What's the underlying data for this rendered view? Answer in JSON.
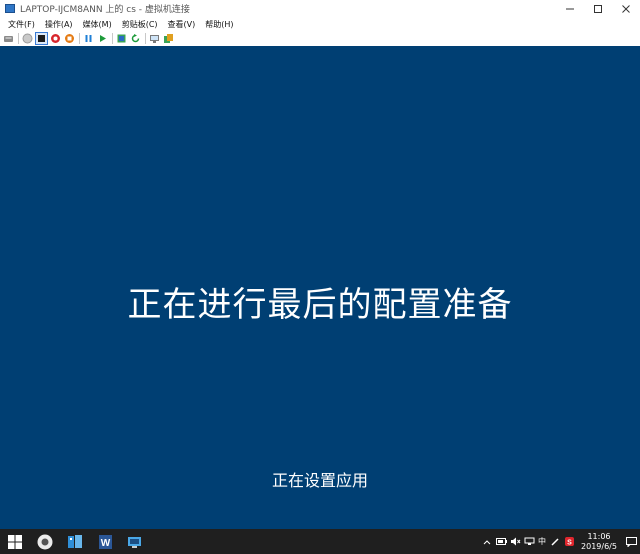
{
  "window": {
    "title": "LAPTOP-IJCM8ANN 上的 cs - 虚拟机连接"
  },
  "menu": {
    "items": [
      "文件(F)",
      "操作(A)",
      "媒体(M)",
      "剪贴板(C)",
      "查看(V)",
      "帮助(H)"
    ]
  },
  "toolbar": {
    "icons": [
      "ctrl-alt-del-icon",
      "start-icon",
      "turn-off-icon",
      "shutdown-icon",
      "save-icon",
      "pause-icon",
      "resume-icon",
      "checkpoint-icon",
      "revert-icon",
      "enhanced-session-icon",
      "share-icon"
    ]
  },
  "vm": {
    "background": "#003f73",
    "main_message": "正在进行最后的配置准备",
    "sub_message": "正在设置应用"
  },
  "taskbar": {
    "apps": [
      "start-icon",
      "chrome-like-icon",
      "hyperv-manager-icon",
      "word-icon",
      "vm-connection-icon"
    ],
    "tray_ime": "中",
    "clock_time": "11:06",
    "clock_date": "2019/6/5"
  }
}
